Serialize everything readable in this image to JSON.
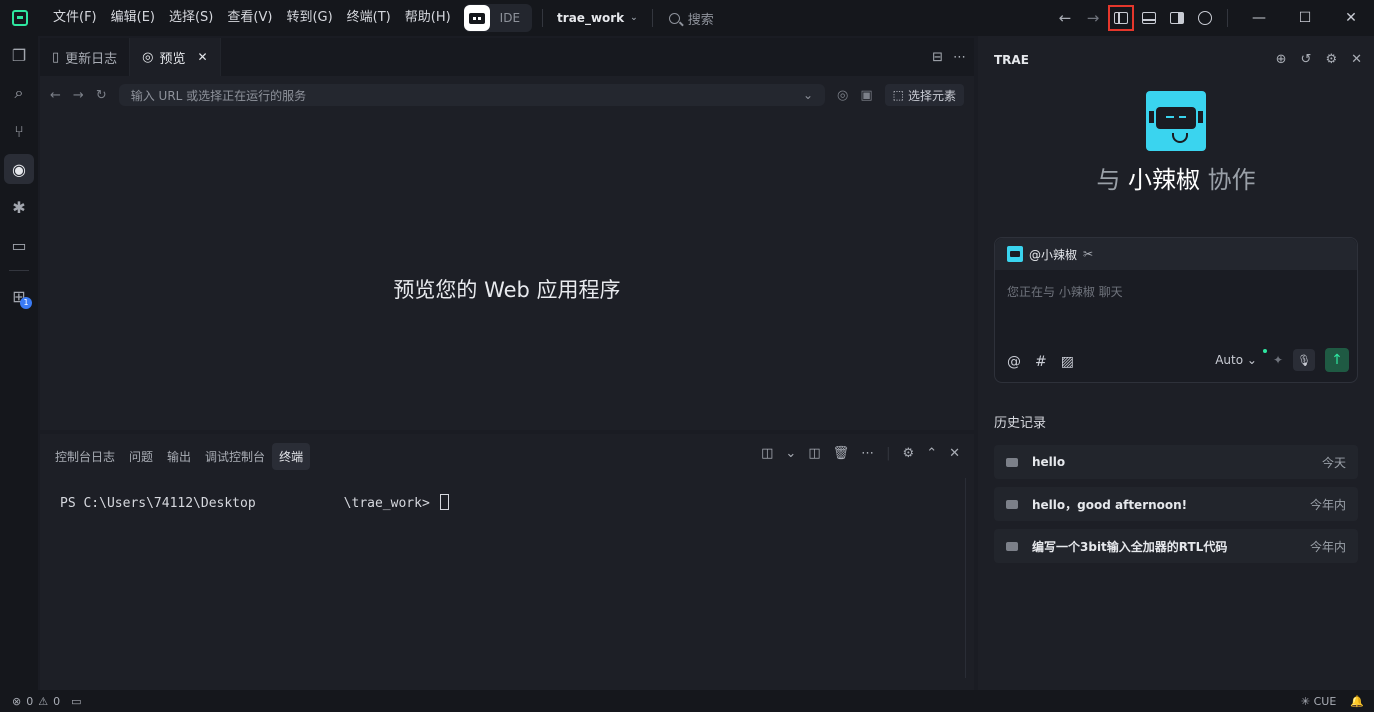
{
  "titlebar": {
    "menu": [
      "文件(F)",
      "编辑(E)",
      "选择(S)",
      "查看(V)",
      "转到(G)",
      "终端(T)",
      "帮助(H)"
    ],
    "mode_label": "IDE",
    "workspace": "trae_work",
    "search_label": "搜索"
  },
  "editor": {
    "tabs": [
      {
        "label": "更新日志"
      },
      {
        "label": "预览"
      }
    ],
    "address_placeholder": "输入 URL 或选择正在运行的服务",
    "select_element_label": "选择元素",
    "preview_message": "预览您的 Web 应用程序"
  },
  "panel": {
    "tabs": [
      "控制台日志",
      "问题",
      "输出",
      "调试控制台",
      "终端"
    ],
    "active_tab": "终端",
    "terminal": {
      "prompt_start": "PS C:\\Users\\74112\\Desktop",
      "prompt_end": "\\trae_work> "
    }
  },
  "chat": {
    "title": "TRAE",
    "collab_prefix": "与",
    "agent_name": "小辣椒",
    "collab_suffix": "协作",
    "mention": "@小辣椒",
    "placeholder": "您正在与 小辣椒 聊天",
    "model_label": "Auto",
    "history_title": "历史记录",
    "history": [
      {
        "text": "hello",
        "when": "今天"
      },
      {
        "text": "hello，good afternoon!",
        "when": "今年内"
      },
      {
        "text": "编写一个3bit输入全加器的RTL代码",
        "when": "今年内"
      }
    ]
  },
  "activitybar": {
    "extensions_badge": "1"
  },
  "statusbar": {
    "errors": "0",
    "warnings": "0",
    "cue_label": "CUE"
  },
  "colors": {
    "accent": "#2ee6a0",
    "bot_brand": "#3ad4ef",
    "highlight_outline": "#e5372c"
  }
}
